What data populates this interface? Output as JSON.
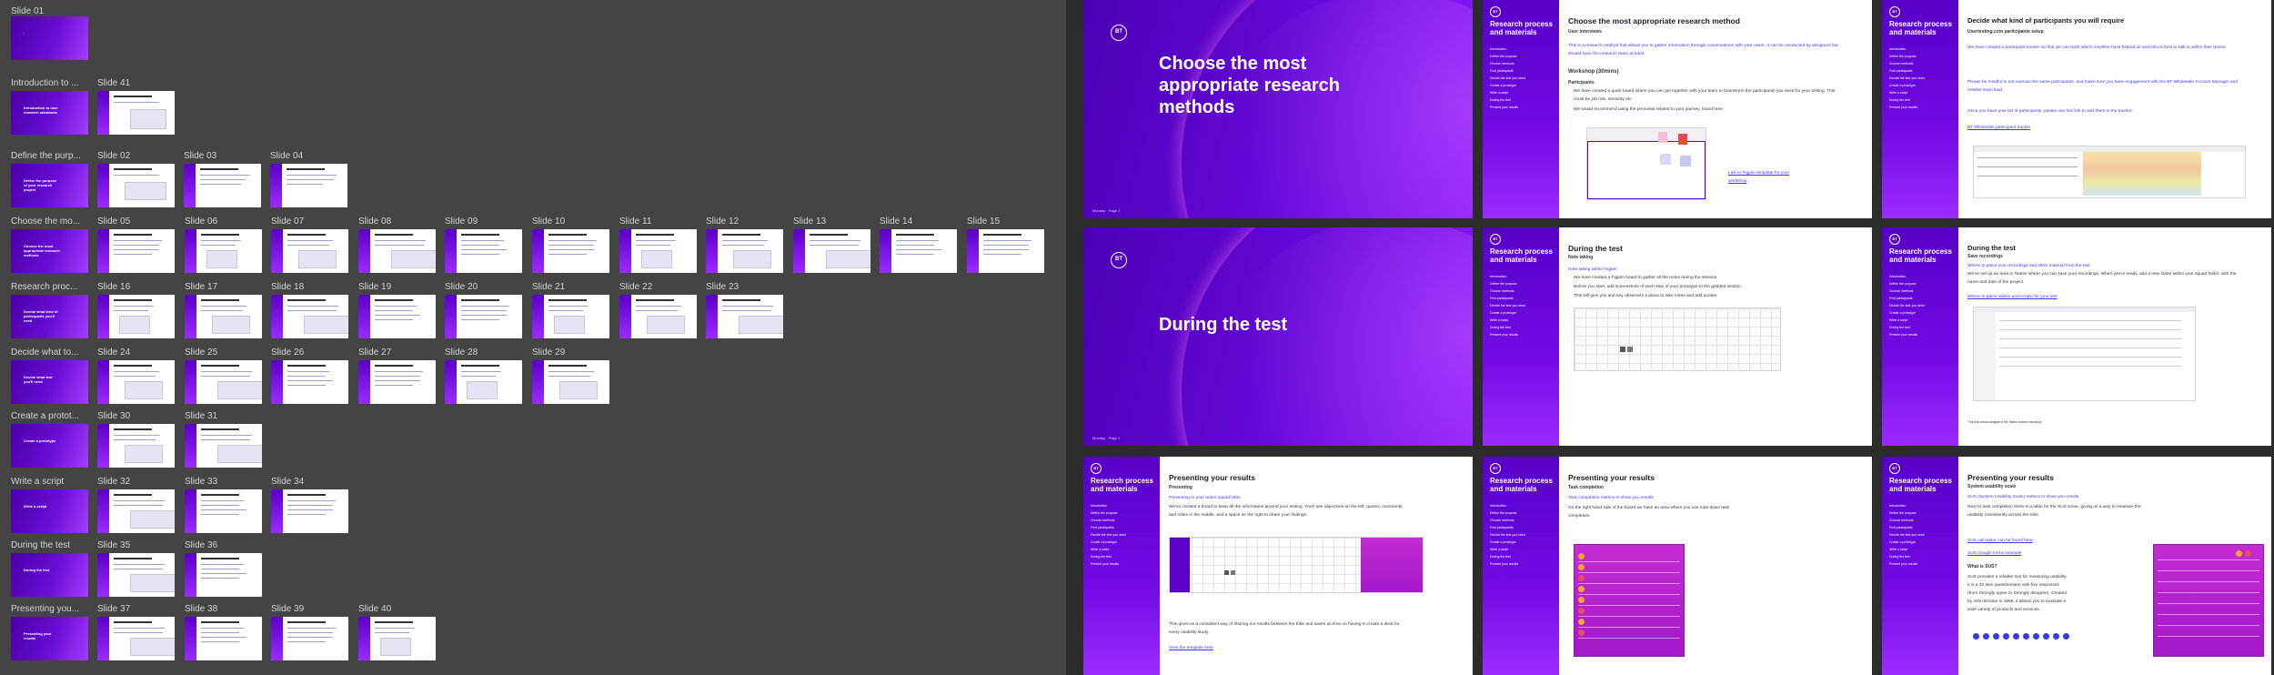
{
  "left_panel": {
    "sections": [
      {
        "label": "Slide 01"
      },
      {
        "label": "Introduction to ..."
      },
      {
        "label": "Define the purp..."
      },
      {
        "label": "Choose the mo..."
      },
      {
        "label": "Research proc..."
      },
      {
        "label": "Decide what to..."
      },
      {
        "label": "Create a protot..."
      },
      {
        "label": "Write a script"
      },
      {
        "label": "During the test"
      },
      {
        "label": "Presenting you..."
      }
    ],
    "cover_texts": [
      "Introduction to user research standards",
      "Define the purpose of your research project",
      "Choose the most appropriate research methods",
      "Decide what kind of participants you'll need",
      "Decide what test you'll need",
      "Create a prototype",
      "Write a script",
      "During the test",
      "Presenting your results"
    ],
    "slide_labels": {
      "r1": [
        "Slide 41"
      ],
      "r2": [
        "Slide 02",
        "Slide 03",
        "Slide 04"
      ],
      "r3": [
        "Slide 05",
        "Slide 06",
        "Slide 07",
        "Slide 08",
        "Slide 09",
        "Slide 10",
        "Slide 11",
        "Slide 12",
        "Slide 13",
        "Slide 14",
        "Slide 15"
      ],
      "r4": [
        "Slide 16",
        "Slide 17",
        "Slide 18",
        "Slide 19",
        "Slide 20",
        "Slide 21",
        "Slide 22",
        "Slide 23"
      ],
      "r5": [
        "Slide 24",
        "Slide 25",
        "Slide 26",
        "Slide 27",
        "Slide 28",
        "Slide 29"
      ],
      "r6": [
        "Slide 30",
        "Slide 31"
      ],
      "r7": [
        "Slide 32",
        "Slide 33",
        "Slide 34"
      ],
      "r8": [
        "Slide 35",
        "Slide 36"
      ],
      "r9": [
        "Slide 37",
        "Slide 38",
        "Slide 39",
        "Slide 40"
      ]
    }
  },
  "slides": {
    "s1": {
      "logo": "BT",
      "title": "Choose the most appropriate research methods",
      "foot": "Monday · Page 1"
    },
    "s2": {
      "sidebar_title": "Research process and materials",
      "heading": "Choose the most appropriate research method",
      "sub": "User interviews",
      "p1": "This is a research method that allows you to gather information through conversations with your users. It can be conducted by designers but should have the research team at hand.",
      "workshop": "Workshop (30mins)",
      "participants": "Participants",
      "b1": "We have created a quick board where you can get together with your team to brainstorm the participants you need for your testing. This could be job role, seniority etc.",
      "b2": "We would recommend using the personas related to your journey, found here.",
      "link": "Link to Figjam template for your workshop"
    },
    "s3": {
      "sidebar_title": "Research process and materials",
      "heading": "Decide what kind of participants you will require",
      "sub": "Usertesting.com participants setup",
      "p1": "We have created a participant tracker so that we can track which resellers have helped us and who is best to talk to within their teams.",
      "p2": "Please be mindful to not overuse the same participants, and make sure you have engagement with the BT Wholesale Account Manager and reseller team lead.",
      "p3": "Once you have your list of participants, please use this link to add them to the tracker:",
      "link": "BT Wholesale participant tracker"
    },
    "s4": {
      "logo": "BT",
      "title": "During the test",
      "foot": "Monday · Page 1"
    },
    "s5": {
      "sidebar_title": "Research process and materials",
      "heading": "During the test",
      "sub": "Note taking",
      "link": "Note taking within Figjam",
      "b1": "We have created a Figjam board to gather all the notes during the session.",
      "b2": "Before you start, add screenshots of each step of your prototype to the gridded section.",
      "b3": "This will give you and any observers a place to take notes and add quotes."
    },
    "s6": {
      "sidebar_title": "Research process and materials",
      "heading": "During the test",
      "sub": "Save recordings",
      "link1": "Where to place your recordings and other material from the test",
      "p1": "We've set up an area in Teams where you can save your recordings. When you're ready, add a new folder within your squad folder, with the name and date of the project.",
      "link2": "Where to place videos and scripts for your test",
      "note": "*The link should navigate to the Teams channel repository"
    },
    "s7": {
      "sidebar_title": "Research process and materials",
      "heading": "Presenting your results",
      "sub": "Presenting",
      "link": "Presenting to your team/ squad/ tribe",
      "p1": "We've created a board to keep all the information around your testing. You'll see objectives on the left, quotes, comments and notes in the middle, and a space on the right to share your findings.",
      "p2": "This gives us a consistent way of sharing our results between the tribe and saves us time on having to create a deck for every usability study.",
      "link2": "View the template here"
    },
    "s8": {
      "sidebar_title": "Research process and materials",
      "heading": "Presenting your results",
      "sub": "Task completion",
      "link": "Task completion metrics to show you results",
      "p1": "On the right hand side of the board we have an area where you can note down task completion:"
    },
    "s9": {
      "sidebar_title": "Research process and materials",
      "heading": "Presenting your results",
      "sub": "System usability scale",
      "link1": "SUS (System Usability Scale) metrics to show you results",
      "p1": "Next to task completion there is a table for the SUS score, giving us a way to measure the usability consistently across the tribe.",
      "link2": "SUS calculator can be found here",
      "link3": "SUS Google forms example",
      "what": "What is SUS?",
      "p2": "SUS provides a reliable tool for measuring usability. It is a 10 item questionnaire with five responses (from Strongly agree to Strongly disagree). Created by John Brooke in 1986, it allows you to evaluate a wide variety of products and services."
    },
    "sidebar_items": [
      "Introduction",
      "Define the purpose",
      "Choose methods",
      "Find participants",
      "Decide the test you need",
      "Create a prototype",
      "Write a script",
      "During the test",
      "Present your results"
    ]
  },
  "colors": {
    "brand_purple": "#6408d8",
    "link_blue": "#3b38e8",
    "canvas": "#2c2c2c",
    "panel": "#444444"
  }
}
